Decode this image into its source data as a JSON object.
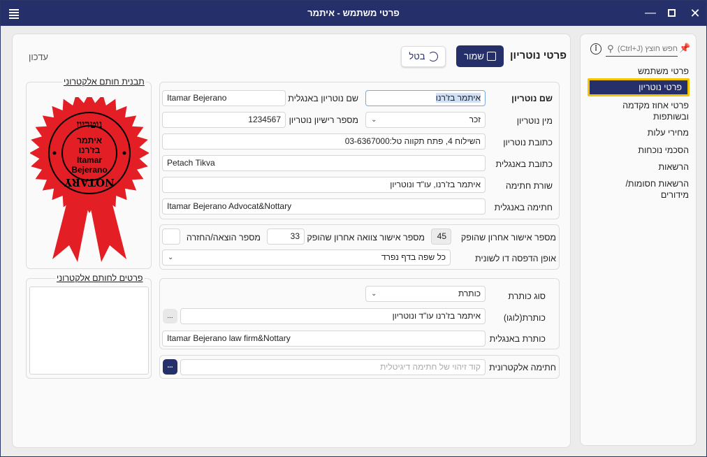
{
  "window": {
    "title": "פרטי משתמש - איתמר"
  },
  "sidebar": {
    "search_placeholder": "חפש חוצץ (Ctrl+J)",
    "items": [
      {
        "label": "פרטי משתמש"
      },
      {
        "label": "פרטי נוטריון",
        "selected": true
      },
      {
        "label": "פרטי אחוז מקדמה ובשותפות"
      },
      {
        "label": "מחירי עלות"
      },
      {
        "label": "הסכמי נוכחות"
      },
      {
        "label": "הרשאות"
      },
      {
        "label": "הרשאות חסומות/ מידורים"
      }
    ]
  },
  "header": {
    "title": "פרטי נוטריון",
    "save_label": "שמור",
    "cancel_label": "בטל",
    "update_label": "עדכון"
  },
  "details": {
    "name_label": "שם נוטריון",
    "name_value": "איתמר בז'רנו",
    "name_en_label": "שם נוטריון באנגלית",
    "name_en_value": "Itamar Bejerano",
    "gender_label": "מין נוטריון",
    "gender_value": "זכר",
    "license_label": "מספר רישיון נוטריון",
    "license_value": "1234567",
    "address_label": "כתובת נוטריון",
    "address_value": "השילוח 4, פתח תקווה טל:03-6367000",
    "address_en_label": "כתובת באנגלית",
    "address_en_value": "Petach Tikva",
    "sigline_label": "שורת חתימה",
    "sigline_value": "איתמר בז'רנו, עו\"ד ונוטריון",
    "sig_en_label": "חתימה באנגלית",
    "sig_en_value": "Itamar Bejerano Advocat&Nottary"
  },
  "approvals": {
    "last_label": "מספר אישור אחרון שהופק",
    "last_value": "45",
    "will_label": "מספר אישור צוואה אחרון שהופק",
    "will_value": "33",
    "return_label": "מספר הוצאה/החזרה",
    "return_value": "",
    "print_label": "אופן הדפסה דו לשונית",
    "print_value": "כל שפה בדף נפרד"
  },
  "heading": {
    "type_label": "סוג כותרת",
    "type_value": "כותרת",
    "logo_label": "כותרת(לוגו)",
    "logo_value": "איתמר בז'רנו עו\"ד ונוטריון",
    "logo_btn": "...",
    "en_label": "כותרת באנגלית",
    "en_value": "Itamar Bejerano law firm&Nottary"
  },
  "esig": {
    "label": "חתימה אלקטרונית",
    "placeholder": "קוד זיהוי של חתימה דיגיטלית",
    "btn": "..."
  },
  "stamp": {
    "legend": "תבנית חותם אלקטרוני",
    "top_text": "נוטריון",
    "bottom_text": "NOTARY",
    "line1": "איתמר",
    "line2": "בז'רנו",
    "line3": "Itamar",
    "line4": "Bejerano"
  },
  "stamp_details": {
    "legend": "פרטים לחותם אלקטרוני"
  },
  "colors": {
    "navy": "#25306a",
    "accent": "#f5c400",
    "stamp_red": "#e31e24"
  }
}
